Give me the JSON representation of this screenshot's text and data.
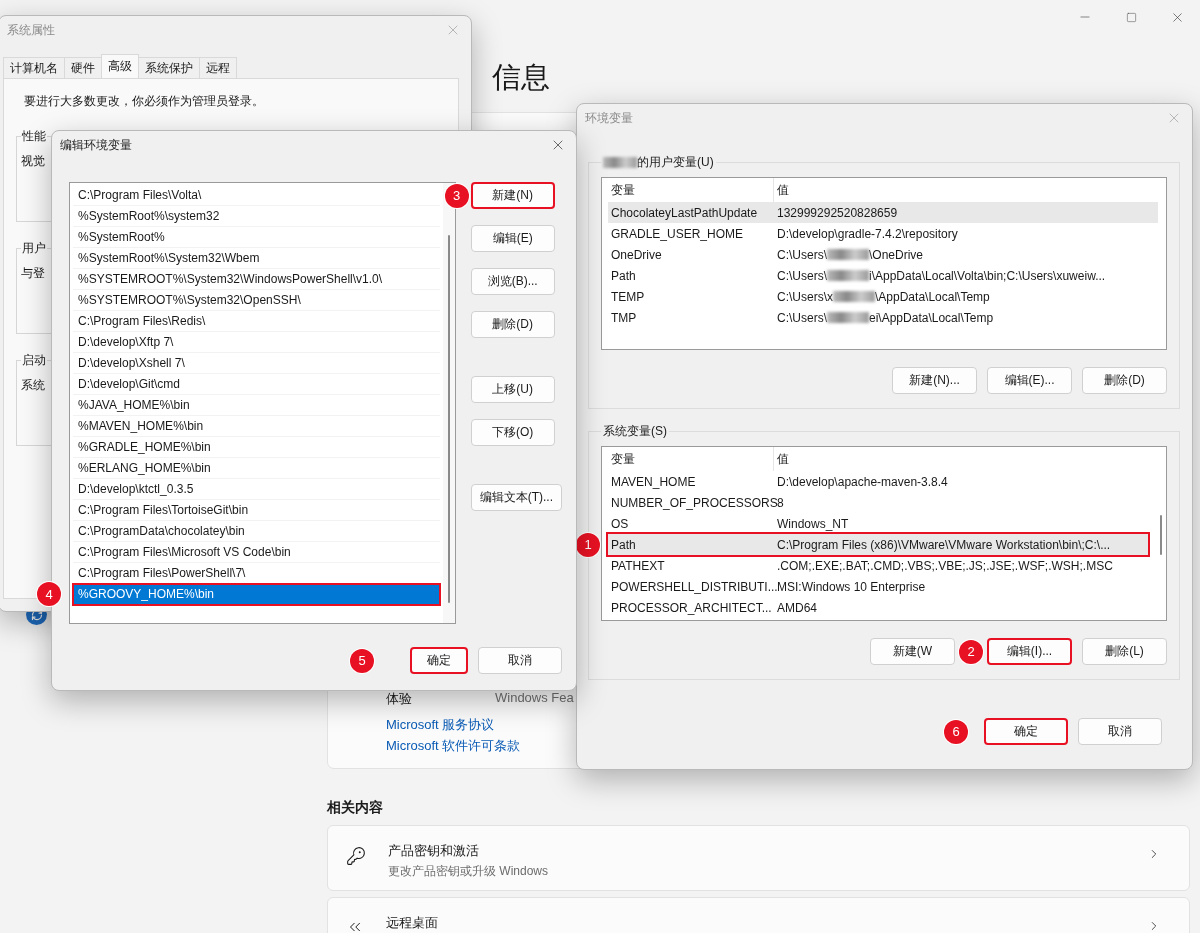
{
  "settings": {
    "heading": "信息",
    "info_card": {
      "rows": [
        {
          "label": "体验",
          "value": "Windows Fea"
        }
      ],
      "links": [
        "Microsoft 服务协议",
        "Microsoft 软件许可条款"
      ]
    },
    "related": {
      "title": "相关内容",
      "items": [
        {
          "kind": "key",
          "title": "产品密钥和激活",
          "subtitle": "更改产品密钥或升级 Windows"
        },
        {
          "kind": "remote",
          "title": "远程桌面"
        }
      ]
    }
  },
  "system_properties": {
    "title": "系统属性",
    "active": false,
    "tabs": [
      {
        "label": "计算机名",
        "selected": false
      },
      {
        "label": "硬件",
        "selected": false
      },
      {
        "label": "高级",
        "selected": true
      },
      {
        "label": "系统保护",
        "selected": false
      },
      {
        "label": "远程",
        "selected": false
      }
    ],
    "notice": "要进行大多数更改，你必须作为管理员登录。",
    "groups": [
      {
        "title": "性能",
        "text": "视觉"
      },
      {
        "title": "用户",
        "text": "与登"
      },
      {
        "title": "启动",
        "text": "系统"
      }
    ]
  },
  "environment_dialog": {
    "title": "环境变量",
    "active": false,
    "user_vars": {
      "label": "的用户变量(U)",
      "label_redacted": true,
      "columns": [
        "变量",
        "值"
      ],
      "rows": [
        {
          "name": "ChocolateyLastPathUpdate",
          "value": "132999292520828659",
          "selected": true
        },
        {
          "name": "GRADLE_USER_HOME",
          "value": "D:\\develop\\gradle-7.4.2\\repository",
          "selected": false
        },
        {
          "name": "OneDrive",
          "value": "C:\\Users\\",
          "redacted": true,
          "value_tail": "\\OneDrive",
          "selected": false
        },
        {
          "name": "Path",
          "value": "C:\\Users\\",
          "redacted": true,
          "value_tail": "i\\AppData\\Local\\Volta\\bin;C:\\Users\\xuweiw...",
          "selected": false
        },
        {
          "name": "TEMP",
          "value": "C:\\Users\\x",
          "redacted": true,
          "value_tail": "\\AppData\\Local\\Temp",
          "selected": false
        },
        {
          "name": "TMP",
          "value": "C:\\Users\\",
          "redacted": true,
          "value_tail": "ei\\AppData\\Local\\Temp",
          "selected": false
        }
      ],
      "buttons": [
        {
          "label": "新建(N)..."
        },
        {
          "label": "编辑(E)..."
        },
        {
          "label": "删除(D)"
        }
      ]
    },
    "system_vars": {
      "label": "系统变量(S)",
      "columns": [
        "变量",
        "值"
      ],
      "rows": [
        {
          "name": "MAVEN_HOME",
          "value": "D:\\develop\\apache-maven-3.8.4",
          "selected": false
        },
        {
          "name": "NUMBER_OF_PROCESSORS",
          "value": "8",
          "selected": false
        },
        {
          "name": "OS",
          "value": "Windows_NT",
          "selected": false
        },
        {
          "name": "Path",
          "value": "C:\\Program Files (x86)\\VMware\\VMware Workstation\\bin\\;C:\\...",
          "selected": true,
          "callout": "1"
        },
        {
          "name": "PATHEXT",
          "value": ".COM;.EXE;.BAT;.CMD;.VBS;.VBE;.JS;.JSE;.WSF;.WSH;.MSC",
          "selected": false
        },
        {
          "name": "POWERSHELL_DISTRIBUTI...",
          "value": "MSI:Windows 10 Enterprise",
          "selected": false
        },
        {
          "name": "PROCESSOR_ARCHITECT...",
          "value": "AMD64",
          "selected": false
        }
      ],
      "buttons": [
        {
          "label": "新建(W"
        },
        {
          "label": "编辑(I)...",
          "callout": "2"
        },
        {
          "label": "删除(L)"
        }
      ]
    },
    "footer_buttons": [
      {
        "label": "确定",
        "callout": "6"
      },
      {
        "label": "取消"
      }
    ]
  },
  "edit_dialog": {
    "title": "编辑环境变量",
    "active": true,
    "entries": [
      {
        "text": "C:\\Program Files\\Volta\\",
        "selected": false
      },
      {
        "text": "%SystemRoot%\\system32",
        "selected": false
      },
      {
        "text": "%SystemRoot%",
        "selected": false
      },
      {
        "text": "%SystemRoot%\\System32\\Wbem",
        "selected": false
      },
      {
        "text": "%SYSTEMROOT%\\System32\\WindowsPowerShell\\v1.0\\",
        "selected": false
      },
      {
        "text": "%SYSTEMROOT%\\System32\\OpenSSH\\",
        "selected": false
      },
      {
        "text": "C:\\Program Files\\Redis\\",
        "selected": false
      },
      {
        "text": "D:\\develop\\Xftp 7\\",
        "selected": false
      },
      {
        "text": "D:\\develop\\Xshell 7\\",
        "selected": false
      },
      {
        "text": "D:\\develop\\Git\\cmd",
        "selected": false
      },
      {
        "text": "%JAVA_HOME%\\bin",
        "selected": false
      },
      {
        "text": "%MAVEN_HOME%\\bin",
        "selected": false
      },
      {
        "text": "%GRADLE_HOME%\\bin",
        "selected": false
      },
      {
        "text": "%ERLANG_HOME%\\bin",
        "selected": false
      },
      {
        "text": "D:\\develop\\ktctl_0.3.5",
        "selected": false
      },
      {
        "text": "C:\\Program Files\\TortoiseGit\\bin",
        "selected": false
      },
      {
        "text": "C:\\ProgramData\\chocolatey\\bin",
        "selected": false
      },
      {
        "text": "C:\\Program Files\\Microsoft VS Code\\bin",
        "selected": false
      },
      {
        "text": "C:\\Program Files\\PowerShell\\7\\",
        "selected": false
      },
      {
        "text": "%GROOVY_HOME%\\bin",
        "selected": true,
        "callout": "4"
      }
    ],
    "button_groups": [
      [
        {
          "label": "新建(N)",
          "callout": "3"
        },
        {
          "label": "编辑(E)"
        },
        {
          "label": "浏览(B)..."
        },
        {
          "label": "删除(D)"
        }
      ],
      [
        {
          "label": "上移(U)"
        },
        {
          "label": "下移(O)"
        }
      ],
      [
        {
          "label": "编辑文本(T)..."
        }
      ]
    ],
    "footer_buttons": [
      {
        "label": "确定",
        "callout": "5"
      },
      {
        "label": "取消"
      }
    ]
  }
}
